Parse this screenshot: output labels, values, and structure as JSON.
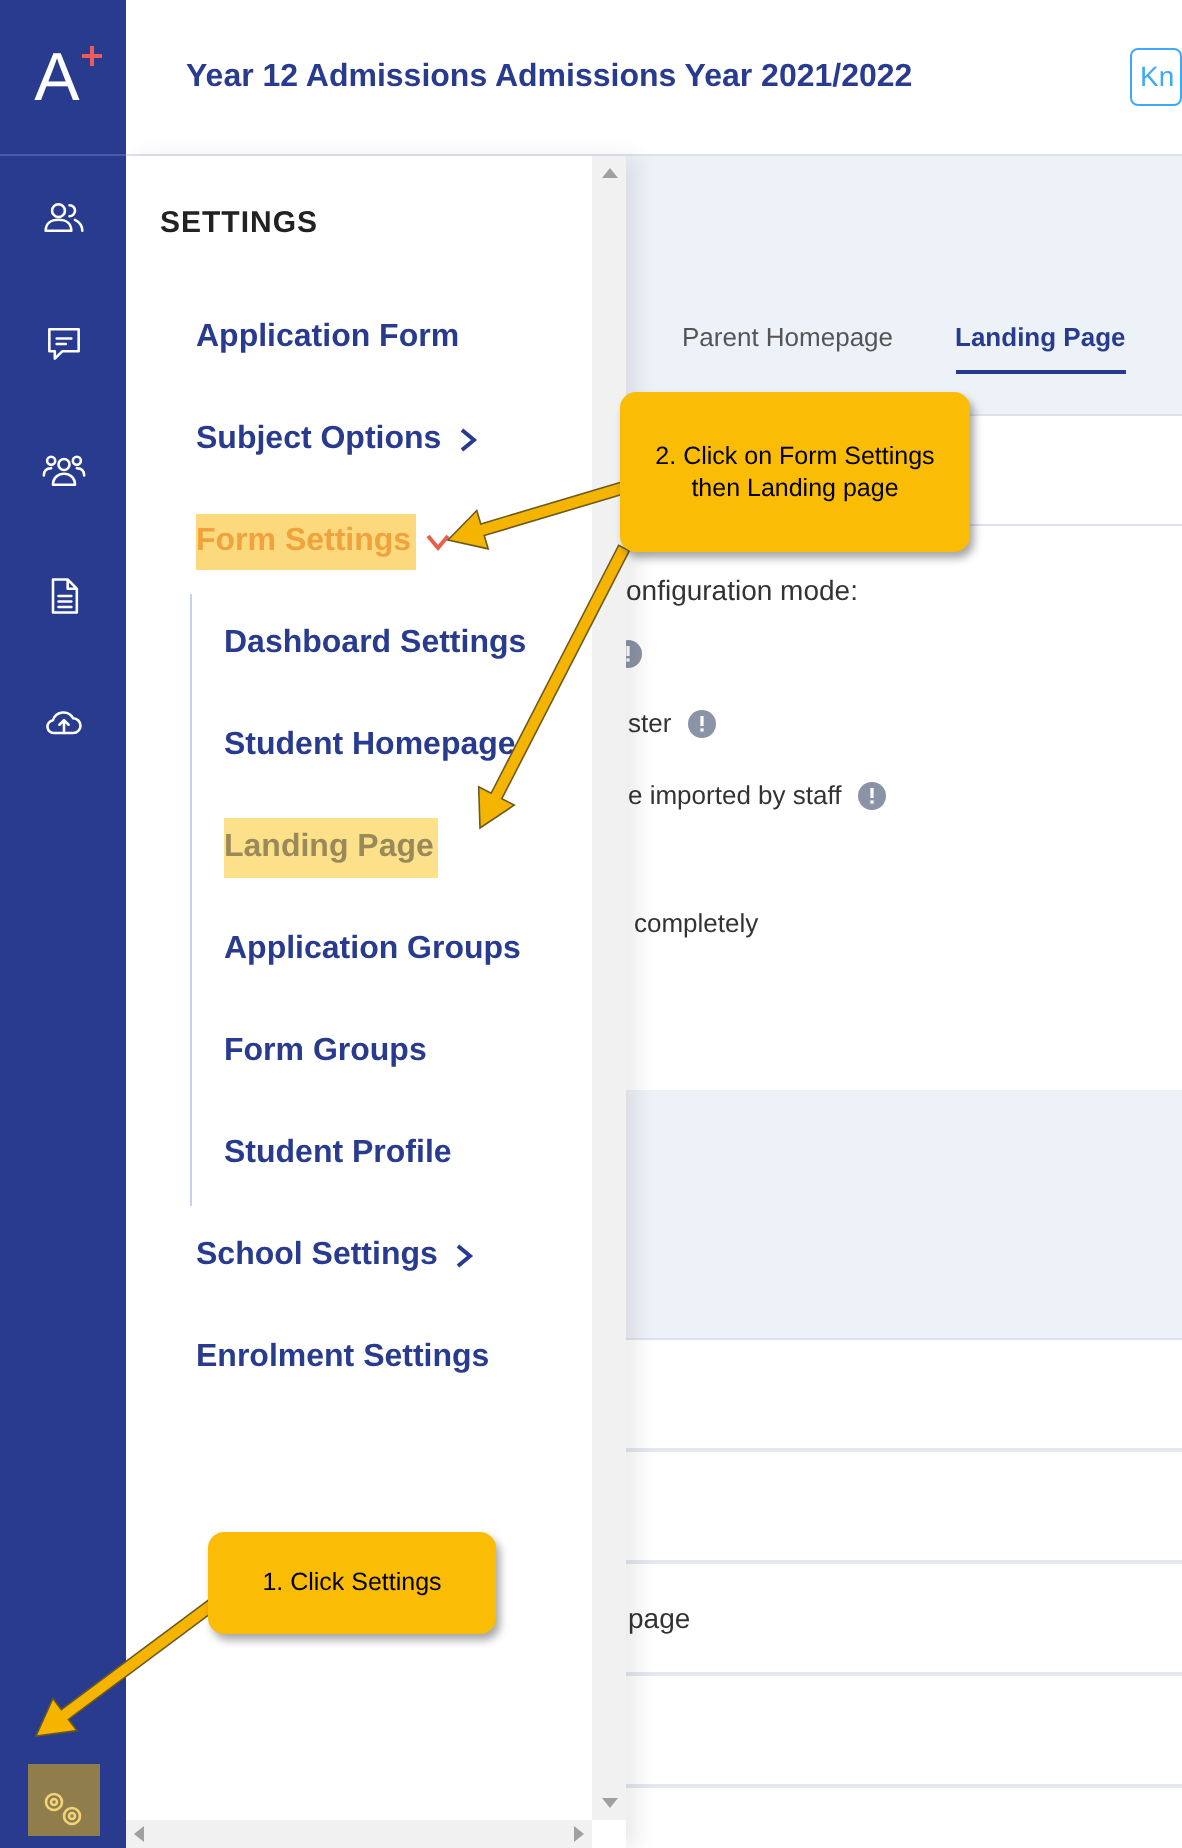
{
  "rail": {
    "logo": "A",
    "settings_selected": true
  },
  "header": {
    "title": "Year 12 Admissions Admissions Year 2021/2022",
    "button": "Kn"
  },
  "settings_menu": {
    "heading": "SETTINGS",
    "items": [
      {
        "label": "Application Form",
        "kind": "link",
        "selected": false
      },
      {
        "label": "Subject Options",
        "kind": "group",
        "expanded": false,
        "selected": false
      },
      {
        "label": "Form Settings",
        "kind": "group",
        "expanded": true,
        "selected": true,
        "children": [
          {
            "label": "Dashboard Settings",
            "selected": false
          },
          {
            "label": "Student Homepage",
            "selected": false
          },
          {
            "label": "Landing Page",
            "selected": true
          },
          {
            "label": "Application Groups",
            "selected": false
          },
          {
            "label": "Form Groups",
            "selected": false
          },
          {
            "label": "Student Profile",
            "selected": false
          }
        ]
      },
      {
        "label": "School Settings",
        "kind": "group",
        "expanded": false,
        "selected": false
      },
      {
        "label": "Enrolment Settings",
        "kind": "link",
        "selected": false
      }
    ]
  },
  "page": {
    "tabs": [
      {
        "label": "Parent Homepage",
        "selected": false
      },
      {
        "label": "Landing Page",
        "selected": true
      }
    ],
    "mode_label": "onfiguration mode:",
    "options": [
      {
        "text": "ster",
        "info": true
      },
      {
        "text": "e imported by staff",
        "info": true
      }
    ],
    "note": "completely",
    "row_text": "page"
  },
  "callouts": [
    {
      "text": "2. Click on Form Settings then Landing page"
    },
    {
      "text": "1. Click Settings"
    }
  ]
}
